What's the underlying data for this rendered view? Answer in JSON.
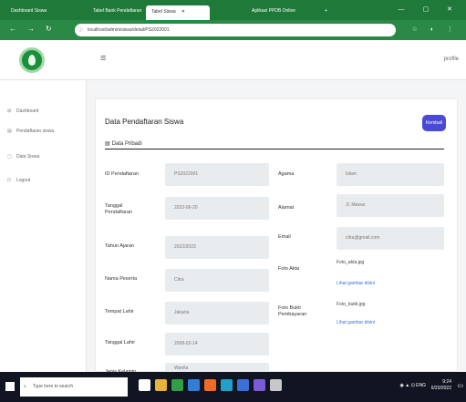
{
  "browser": {
    "tabs": [
      {
        "label": "Dashboard Siswa",
        "active": false
      },
      {
        "label": "Tabel Bank Pendaftaran",
        "active": false
      },
      {
        "label": "Tabel Siswa",
        "active": true
      },
      {
        "label": "Aplikasi PPDB Online",
        "active": false
      }
    ],
    "new_tab": "+",
    "window_controls": "— ▢ ✕",
    "url": "localhost/admin/siswa/detail/PS2022001",
    "extension_icons": "☆ ◐ ⋮"
  },
  "header": {
    "menu_icon": "≡",
    "user_name": "profile"
  },
  "sidebar": {
    "items": [
      {
        "icon": "⊞",
        "label": "Dashboard"
      },
      {
        "icon": "▤",
        "label": "Pendaftaran siswa"
      },
      {
        "icon": "▢",
        "label": "Data Siswa"
      },
      {
        "icon": "⏻",
        "label": "Logout"
      }
    ]
  },
  "main": {
    "title": "Data Pendaftaran Siswa",
    "action_button": "Kembali",
    "section_title": "Data Pribadi",
    "section_icon": "▤",
    "left_fields": [
      {
        "label": "ID Pendaftaran",
        "value": "PS2022001"
      },
      {
        "label": "Tanggal Pendaftaran",
        "value": "2022-06-20"
      },
      {
        "label": "Tahun Ajaran",
        "value": "2022/2023"
      },
      {
        "label": "Nama Peserta",
        "value": "Citra"
      },
      {
        "label": "Tempat Lahir",
        "value": "Jakarta"
      },
      {
        "label": "Tanggal Lahir",
        "value": "2008-02-14"
      },
      {
        "label": "Jenis Kelamin",
        "value": "Wanita"
      }
    ],
    "right_fields": [
      {
        "label": "Agama",
        "value": "Islam"
      },
      {
        "label": "Alamat",
        "value": "Jl. Mawar"
      },
      {
        "label": "Email",
        "value": "citra@gmail.com"
      }
    ],
    "attachments": [
      {
        "label": "Foto Akta",
        "filename": "Foto_akta.jpg",
        "link": "Lihat gambar disini"
      },
      {
        "label": "Foto Bukti Pembayaran",
        "filename": "Foto_bukti.jpg",
        "link": "Lihat gambar disini"
      }
    ]
  },
  "taskbar": {
    "search_placeholder": "Type here to search",
    "tray": "◉ ▲ ⊡ ENG",
    "time": "9:24",
    "date": "6/20/2022",
    "apps": [
      {
        "name": "task-view",
        "color": "#ffffff"
      },
      {
        "name": "file-explorer",
        "color": "#e8b33a"
      },
      {
        "name": "chrome",
        "color": "#2f9e44"
      },
      {
        "name": "vscode",
        "color": "#2f7fd6"
      },
      {
        "name": "xampp",
        "color": "#f26b21"
      },
      {
        "name": "edge",
        "color": "#1fa1c9"
      },
      {
        "name": "store",
        "color": "#3b6fd8"
      },
      {
        "name": "photos",
        "color": "#7c5cd6"
      },
      {
        "name": "settings",
        "color": "#c8c8c8"
      }
    ]
  }
}
